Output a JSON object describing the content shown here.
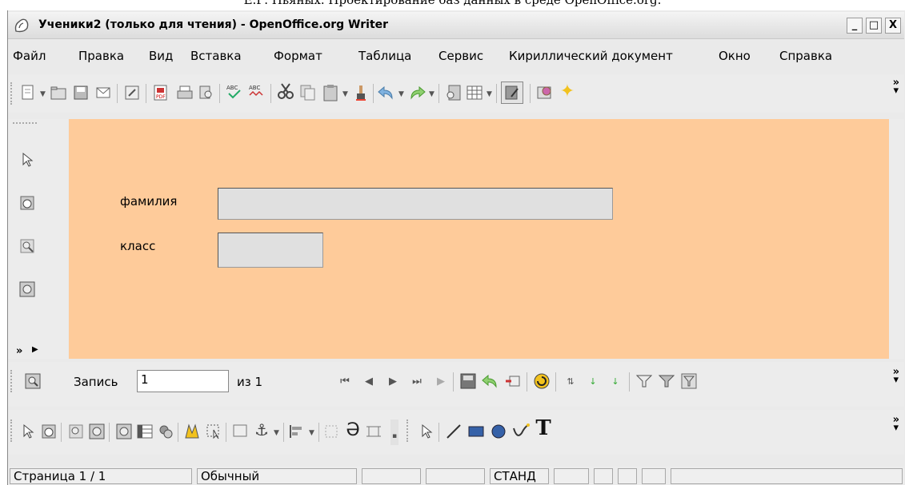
{
  "caption": "Е.Г. Пьяных. Проектирование баз данных в среде OpenOffice.org.",
  "window": {
    "title": "Ученики2 (только для чтения) - OpenOffice.org Writer",
    "buttons": {
      "minimize": "_",
      "maximize": "□",
      "close": "X"
    }
  },
  "menu": [
    "Файл",
    "Правка",
    "Вид",
    "Вставка",
    "Формат",
    "Таблица",
    "Сервис",
    "Кириллический документ",
    "Окно",
    "Справка"
  ],
  "form": {
    "fields": [
      {
        "label": "фамилия",
        "value": ""
      },
      {
        "label": "класс",
        "value": ""
      }
    ],
    "background_color": "#fecb9a"
  },
  "navigation": {
    "record_label": "Запись",
    "record_value": "1",
    "of_label": "из 1"
  },
  "statusbar": {
    "page": "Страница  1 / 1",
    "style": "Обычный",
    "mode": "СТАНД"
  },
  "icons": {
    "standard_toolbar": [
      "new-doc-icon",
      "open-icon",
      "save-icon",
      "email-icon",
      "edit-mode-icon",
      "pdf-export-icon",
      "print-icon",
      "print-preview-icon",
      "spellcheck-icon",
      "autospellcheck-icon",
      "cut-icon",
      "copy-icon",
      "paste-icon",
      "format-paintbrush-icon",
      "undo-icon",
      "redo-icon",
      "navigator-icon",
      "table-icon",
      "show-draw-icon",
      "gallery-icon",
      "stars-icon"
    ],
    "form_design_bar": [
      "select-icon",
      "hand-icon",
      "zoom-icon",
      "zoom-fit-icon"
    ],
    "navigation_toolbar": [
      "find-record-icon",
      "first-record-icon",
      "prev-record-icon",
      "next-record-icon",
      "last-record-icon",
      "new-record-icon",
      "save-record-icon",
      "undo-record-icon",
      "delete-record-icon",
      "refresh-icon",
      "sort-icon",
      "sort-asc-icon",
      "sort-desc-icon",
      "autofilter-icon",
      "standard-filter-icon",
      "apply-filter-icon"
    ],
    "form_controls_toolbar": [
      "select-control-icon",
      "hand-control-icon",
      "control-properties-icon",
      "form-properties-icon",
      "form-navigator-icon",
      "activation-order-icon",
      "add-field-icon",
      "design-mode-icon",
      "wizard-icon",
      "group-icon",
      "anchor-icon",
      "align-icon",
      "position-icon",
      "bring-front-icon",
      "wrap-icon",
      "select-draw-icon",
      "line-icon",
      "rectangle-icon",
      "ellipse-icon",
      "curve-icon",
      "text-icon"
    ]
  }
}
